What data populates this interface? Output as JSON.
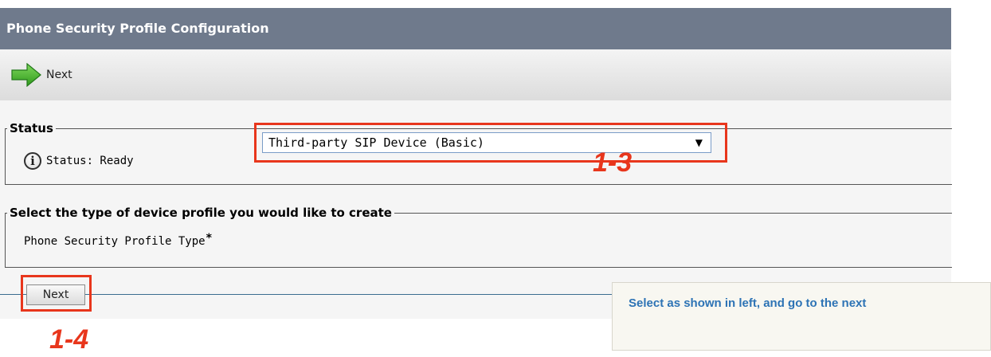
{
  "header": {
    "title": "Phone Security Profile Configuration"
  },
  "toolbar": {
    "next_label": "Next",
    "next_icon": "green-arrow-right"
  },
  "status": {
    "legend": "Status",
    "text": "Status: Ready",
    "icon": "info-icon",
    "icon_glyph": "i"
  },
  "device_profile": {
    "legend": "Select the type of device profile you would like to create",
    "field_label": "Phone Security Profile Type",
    "required_mark": "*",
    "selected_value": "Third-party SIP Device (Basic)"
  },
  "actions": {
    "next_label": "Next"
  },
  "annotations": {
    "step_select": "1-3",
    "step_next": "1-4",
    "note": "Select as shown in left, and go to the next",
    "highlight_color": "#e8361c",
    "note_text_color": "#2d73b5"
  },
  "colors": {
    "title_bar": "#6f7a8c",
    "panel_bg": "#f5f5f5",
    "arrow_green": "#44b02b"
  }
}
